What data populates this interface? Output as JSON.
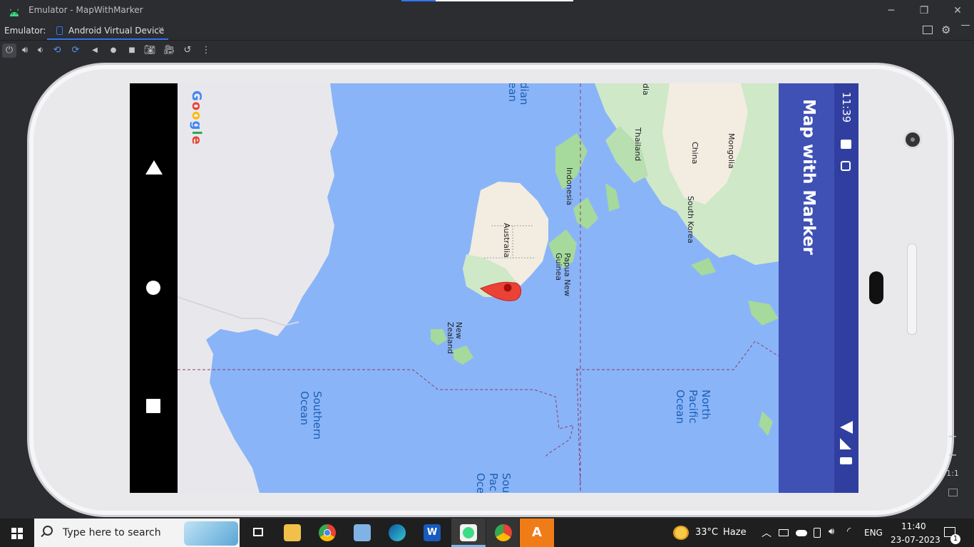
{
  "window": {
    "title": "Emulator - MapWithMarker",
    "controls": {
      "minimize": "─",
      "restore": "❐",
      "close": "✕"
    }
  },
  "tabs": {
    "label": "Emulator:",
    "active_tab": "Android Virtual Device"
  },
  "toolbar": {
    "icons": [
      "power-icon",
      "volume-up-icon",
      "volume-down-icon",
      "rotate-left-icon",
      "rotate-right-icon",
      "back-icon",
      "home-icon",
      "overview-icon",
      "camera-icon",
      "screenrecord-icon",
      "snapshot-icon",
      "more-icon"
    ]
  },
  "device": {
    "status_time": "11:39",
    "app_title": "Map with Marker",
    "map": {
      "logo": "Google",
      "labels": {
        "indian_ocean": "dian\nean",
        "thailand": "Thailand",
        "india": "dia",
        "china": "China",
        "mongolia": "Mongolia",
        "indonesia": "Indonesia",
        "south_korea": "South Korea",
        "australia": "Australia",
        "papua": "Papua New\nGuinea",
        "nz": "New\nZealand",
        "southern_ocean": "Southern\nOcean",
        "north_pacific": "North\nPacific\nOcean",
        "south_pacific": "Sou\nPac\nOce"
      }
    }
  },
  "side_controls": {
    "zoom_in": "+",
    "zoom_out": "−",
    "one_to_one": "1:1"
  },
  "taskbar": {
    "search_placeholder": "Type here to search",
    "weather_temp": "33°C",
    "weather_desc": "Haze",
    "language": "ENG",
    "time": "11:40",
    "date": "23-07-2023",
    "notification_count": "1"
  },
  "colors": {
    "map_water": "#8ab4f8",
    "app_bar": "#3f51b5",
    "status_bar": "#303f9f",
    "marker": "#ea4335"
  }
}
